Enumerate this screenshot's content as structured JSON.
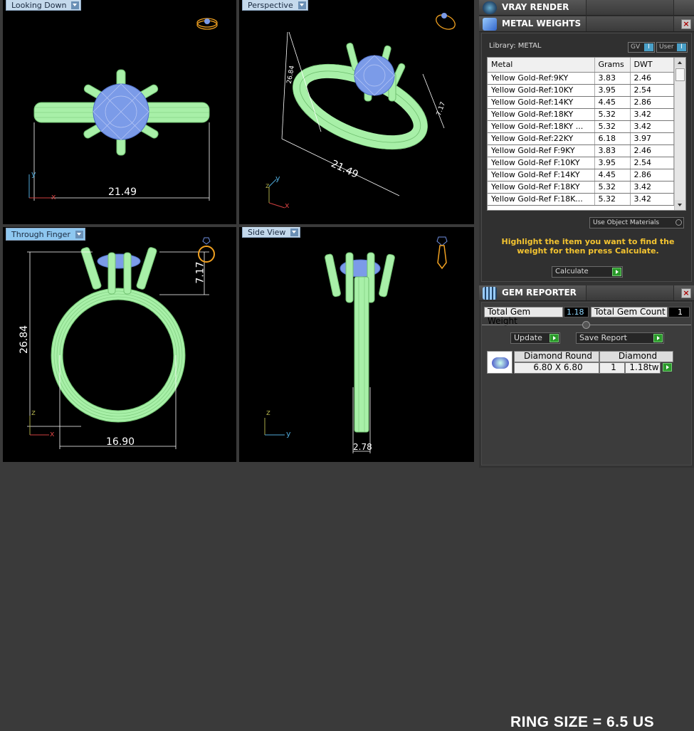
{
  "viewports": [
    {
      "tab": "Looking Down",
      "dimension": "21.49"
    },
    {
      "tab": "Perspective",
      "dimensions": [
        "21.49",
        "7.17",
        "26.84"
      ]
    },
    {
      "tab": "Through Finger",
      "dimensions": [
        "26.84",
        "7.17",
        "16.90"
      ]
    },
    {
      "tab": "Side View",
      "dimension": "2.78"
    }
  ],
  "axes": {
    "x": "x",
    "y": "y",
    "z": "z"
  },
  "vray": {
    "title": "VRAY RENDER"
  },
  "metal_weights": {
    "title": "METAL WEIGHTS",
    "library_label": "Library: METAL",
    "toggle_gv": "GV",
    "toggle_user": "User",
    "toggle_on": "I",
    "columns": [
      "Metal",
      "Grams",
      "DWT"
    ],
    "rows": [
      [
        "Yellow Gold-Ref:9KY",
        "3.83",
        "2.46"
      ],
      [
        "Yellow Gold-Ref:10KY",
        "3.95",
        "2.54"
      ],
      [
        "Yellow Gold-Ref:14KY",
        "4.45",
        "2.86"
      ],
      [
        "Yellow Gold-Ref:18KY",
        "5.32",
        "3.42"
      ],
      [
        "Yellow Gold-Ref:18KY ...",
        "5.32",
        "3.42"
      ],
      [
        "Yellow Gold-Ref:22KY",
        "6.18",
        "3.97"
      ],
      [
        "Yellow Gold-Ref F:9KY",
        "3.83",
        "2.46"
      ],
      [
        "Yellow Gold-Ref F:10KY",
        "3.95",
        "2.54"
      ],
      [
        "Yellow Gold-Ref F:14KY",
        "4.45",
        "2.86"
      ],
      [
        "Yellow Gold-Ref F:18KY",
        "5.32",
        "3.42"
      ],
      [
        "Yellow Gold-Ref F:18K...",
        "5.32",
        "3.42"
      ]
    ],
    "use_object_materials": "Use Object Materials",
    "instruction": "Highlight the item you want to find the weight for then press Calculate.",
    "calculate_label": "Calculate"
  },
  "gem_reporter": {
    "title": "GEM REPORTER",
    "total_weight_label": "Total Gem Weight",
    "total_weight_value": "1.18",
    "total_count_label": "Total Gem Count",
    "total_count_value": "1",
    "update_label": "Update",
    "save_report_label": "Save Report",
    "gem": {
      "name": "Diamond Round",
      "size": "6.80 X 6.80",
      "type": "Diamond",
      "count": "1",
      "weight": "1.18tw"
    }
  },
  "ring_size": "RING SIZE = 6.5 US",
  "colors": {
    "wire_green": "#a8f0a8",
    "stone_blue": "#6f8fe0",
    "highlight_text": "#f4c430",
    "active_tab": "#8ec7f0"
  }
}
